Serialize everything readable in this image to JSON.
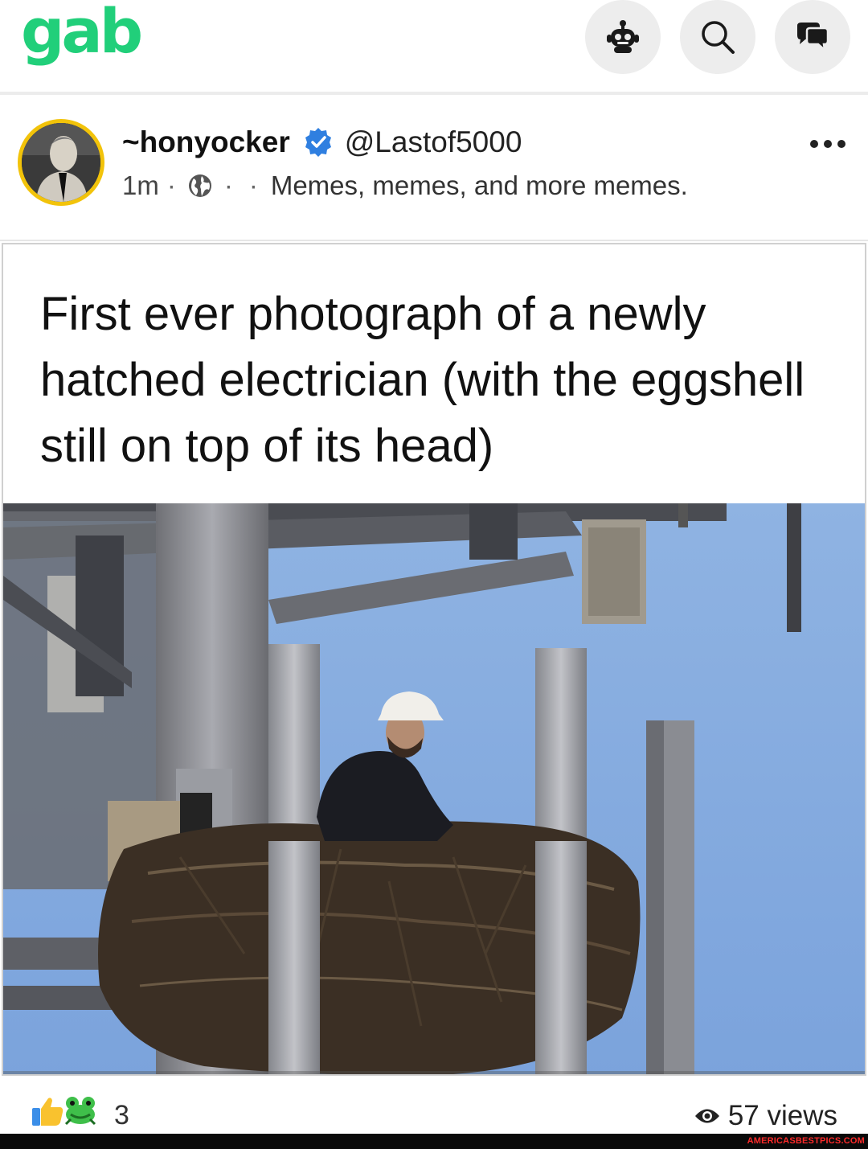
{
  "app": {
    "logo_text": "gab",
    "brand_color": "#21cf7a"
  },
  "topbar": {
    "icons": [
      "robot-icon",
      "search-icon",
      "chat-icon"
    ]
  },
  "post": {
    "author": {
      "display_name": "~honyocker",
      "handle": "@Lastof5000",
      "verified": true,
      "avatar_ring_color": "#f2c30a"
    },
    "time": "1m",
    "separator": "·",
    "visibility_icon": "globe-icon",
    "group": "Memes, memes, and more memes.",
    "more_icon": "ellipsis-icon",
    "meme": {
      "caption": "First ever photograph of a newly hatched electrician (with the eggshell still on top of its head)"
    },
    "reactions": {
      "icons": [
        "thumbs-up-icon",
        "frog-icon"
      ],
      "count": "3"
    },
    "views": "57 views"
  },
  "watermark": "AMERICASBESTPICS.COM"
}
